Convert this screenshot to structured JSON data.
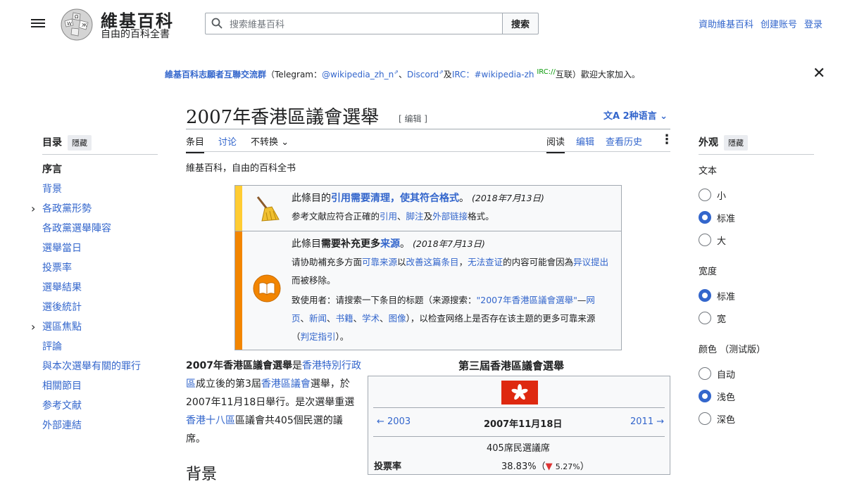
{
  "header": {
    "wordmark": "維基百科",
    "tagline": "自由的百科全書",
    "search_placeholder": "搜索維基百科",
    "search_button": "搜索",
    "user_links": [
      "資助維基百科",
      "创建账号",
      "登录"
    ]
  },
  "notice": {
    "group": "維基百科志願者互聯交流群",
    "paren_open": "（Telegram：",
    "telegram": "@wikipedia_zh_n",
    "sep1": "、",
    "discord": "Discord",
    "and": "及",
    "irc": "IRC：",
    "irc_channel": "#wikipedia-zh",
    "irc_sup": "IRC://",
    "tail": "互联）歡迎大家加入。"
  },
  "toc": {
    "title": "目录",
    "hide": "隱藏",
    "items": [
      {
        "label": "序言",
        "active": true,
        "caret": false
      },
      {
        "label": "背景",
        "caret": false
      },
      {
        "label": "各政黨形勢",
        "caret": true
      },
      {
        "label": "各政黨選舉陣容",
        "caret": false
      },
      {
        "label": "選舉當日",
        "caret": false
      },
      {
        "label": "投票率",
        "caret": false
      },
      {
        "label": "選舉結果",
        "caret": false
      },
      {
        "label": "選後統計",
        "caret": false
      },
      {
        "label": "選區焦點",
        "caret": true
      },
      {
        "label": "評論",
        "caret": false
      },
      {
        "label": "與本次選舉有關的罪行",
        "caret": false
      },
      {
        "label": "相關節目",
        "caret": false
      },
      {
        "label": "参考文献",
        "caret": false
      },
      {
        "label": "外部連結",
        "caret": false
      }
    ]
  },
  "article": {
    "title": "2007年香港區議會選舉",
    "edit_small": "[ 编辑 ]",
    "languages": "2种语言",
    "tabs_left": [
      "条目",
      "讨论",
      "不转换"
    ],
    "tabs_right": [
      "阅读",
      "编辑",
      "查看历史"
    ],
    "tagline": "維基百科，自由的百科全书"
  },
  "ambox": {
    "cleanup": {
      "pre": "此條目的",
      "link": "引用需要清理，使其符合格式",
      "post": "。",
      "date": "(2018年7月13日)",
      "line2_pre": "参考文献应符合正確的",
      "l1": "引用",
      "s1": "、",
      "l2": "脚注",
      "s2": "及",
      "l3": "外部链接",
      "line2_post": "格式。"
    },
    "refimprove": {
      "pre": "此條目",
      "bold": "需要补充更多",
      "link": "来源",
      "post": "。",
      "date": "(2018年7月13日)",
      "p1": "请协助補充多方面",
      "l1": "可靠来源",
      "p2": "以",
      "l2": "改善这篇条目",
      "p3": "，",
      "l3": "无法查证",
      "p4": "的内容可能會因為",
      "l4": "异议提出",
      "p5": "而被移除。",
      "p6": "致使用者：请搜索一下条目的标题（来源搜索：",
      "l5": "\"2007年香港區議會選舉\"",
      "p7": "—",
      "l6": "网页",
      "s6": "、",
      "l7": "新闻",
      "s7": "、",
      "l8": "书籍",
      "s8": "、",
      "l9": "学术",
      "s9": "、",
      "l10": "图像",
      "p8": "），以检查网络上是否存在该主题的更多可靠来源（",
      "l11": "判定指引",
      "p9": "）。"
    }
  },
  "lead": {
    "bold": "2007年香港區議會選舉",
    "t1": "是",
    "l1": "香港特別行政區",
    "t2": "成立後的第3屆",
    "l2": "香港區議會",
    "t3": "選舉，於2007年11月18日舉行。是次選舉重選",
    "l3": "香港十八區",
    "t4": "區議會共405個民選的議席。"
  },
  "background_heading": "背景",
  "infobox": {
    "title": "第三屆香港區議會選舉",
    "prev": "← 2003",
    "date": "2007年11月18日",
    "next": "2011 →",
    "seats": "405席民選議席",
    "turnout_label": "投票率",
    "turnout_value": "38.83%",
    "turnout_change": "5.27%"
  },
  "appearance": {
    "title": "外观",
    "hide": "隱藏",
    "text_label": "文本",
    "text_opts": [
      {
        "label": "小",
        "on": false
      },
      {
        "label": "标准",
        "on": true
      },
      {
        "label": "大",
        "on": false
      }
    ],
    "width_label": "宽度",
    "width_opts": [
      {
        "label": "标准",
        "on": true
      },
      {
        "label": "宽",
        "on": false
      }
    ],
    "color_label": "颜色 （测试版）",
    "color_opts": [
      {
        "label": "自动",
        "on": false
      },
      {
        "label": "浅色",
        "on": true
      },
      {
        "label": "深色",
        "on": false
      }
    ]
  },
  "colors": {
    "link": "#3366cc",
    "cleanup_bar": "#fc3",
    "refimprove_bar": "#f28500",
    "flag": "#de2910"
  }
}
